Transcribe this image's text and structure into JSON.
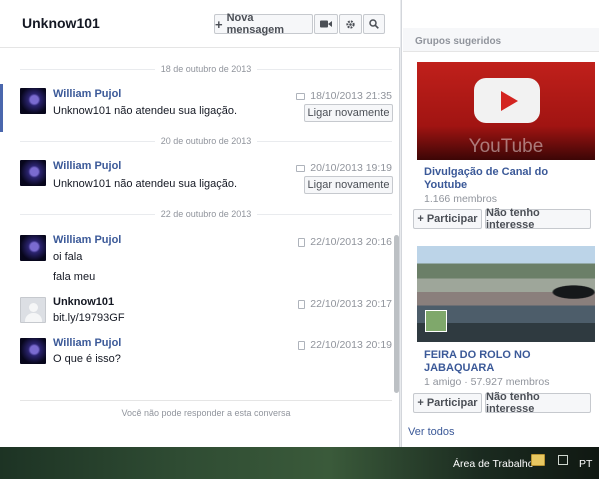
{
  "conversation": {
    "title": "Unknow101",
    "toolbar": {
      "new_message_label": "Nova mensagem",
      "icons": [
        "video-icon",
        "gear-icon",
        "search-icon"
      ]
    },
    "dates": [
      "18 de outubro de 2013",
      "20 de outubro de 2013",
      "22 de outubro de 2013"
    ],
    "messages": [
      {
        "sender": "William Pujol",
        "text": "Unknow101 não atendeu sua ligação.",
        "time": "18/10/2013 21:35",
        "action": "Ligar novamente"
      },
      {
        "sender": "William Pujol",
        "text": "Unknow101 não atendeu sua ligação.",
        "time": "20/10/2013 19:19",
        "action": "Ligar novamente"
      },
      {
        "sender": "William Pujol",
        "lines": [
          "oi fala",
          "fala meu"
        ],
        "time": "22/10/2013 20:16"
      },
      {
        "sender": "Unknow101",
        "text": "bit.ly/19793GF",
        "time": "22/10/2013 20:17"
      },
      {
        "sender": "William Pujol",
        "text": "O que é isso?",
        "time": "22/10/2013 20:19"
      }
    ],
    "composer_notice": "Você não pode responder a esta conversa"
  },
  "sidebar": {
    "title": "Grupos sugeridos",
    "groups": [
      {
        "cover_text": "YouTube",
        "name": "Divulgação de Canal do Youtube",
        "meta": "1.166 membros",
        "join_label": "Participar",
        "dismiss_label": "Não tenho interesse"
      },
      {
        "name": "FEIRA DO ROLO NO JABAQUARA",
        "meta": "1 amigo · 57.927 membros",
        "join_label": "Participar",
        "dismiss_label": "Não tenho interesse"
      }
    ],
    "see_all": "Ver todos"
  },
  "taskbar": {
    "desktop_label": "Área de Trabalho",
    "language": "PT"
  },
  "colors": {
    "link_blue": "#3b5998",
    "muted_gray": "#90949c",
    "youtube_red": "#c0201b"
  }
}
